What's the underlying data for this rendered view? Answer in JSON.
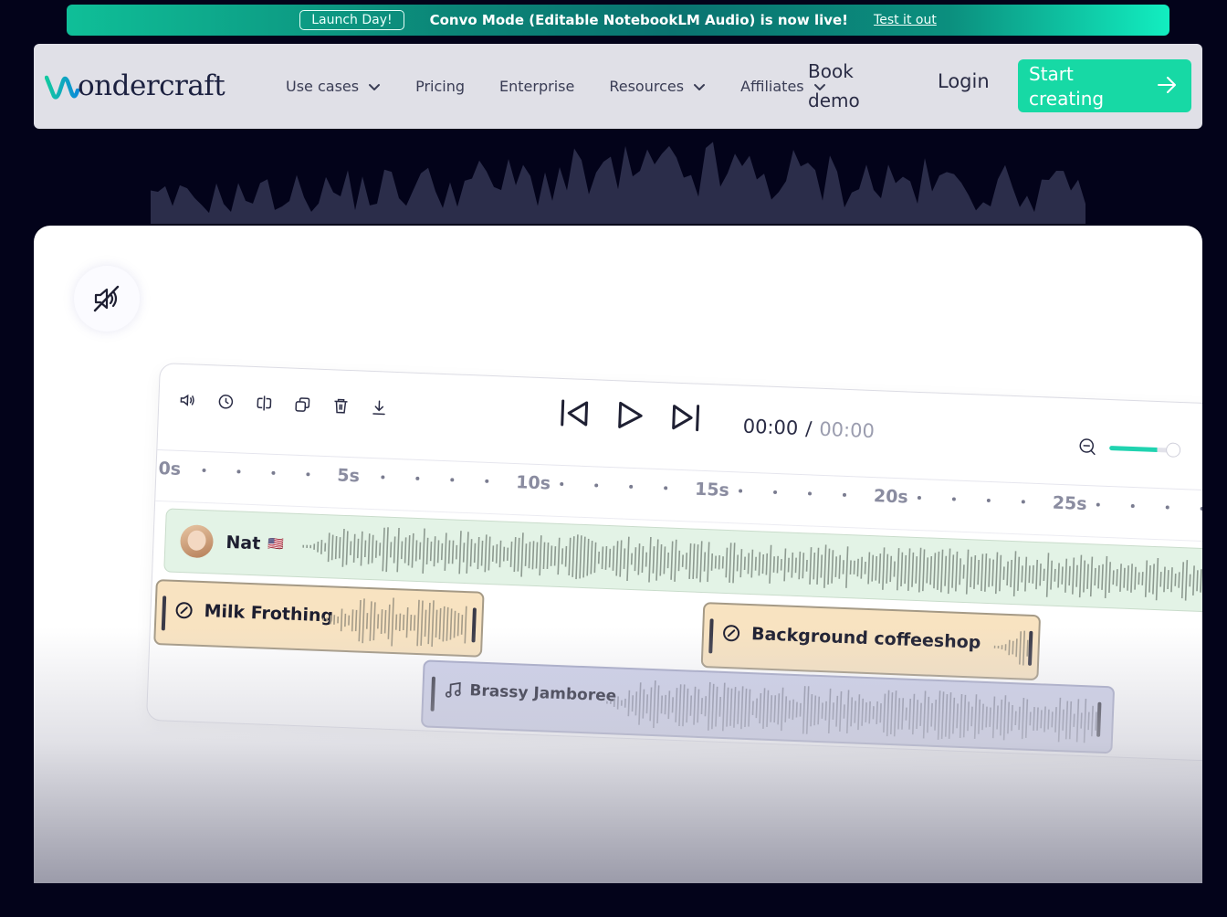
{
  "banner": {
    "tag": "Launch Day!",
    "message": "Convo Mode (Editable NotebookLM Audio) is now live!",
    "cta": "Test it out"
  },
  "nav": {
    "logo_text": "ondercraft",
    "items": [
      {
        "label": "Use cases",
        "has_dropdown": true
      },
      {
        "label": "Pricing",
        "has_dropdown": false
      },
      {
        "label": "Enterprise",
        "has_dropdown": false
      },
      {
        "label": "Resources",
        "has_dropdown": true
      },
      {
        "label": "Affiliates",
        "has_dropdown": true
      }
    ],
    "book_demo_line1": "Book",
    "book_demo_line2": "demo",
    "login": "Login",
    "start_line1": "Start",
    "start_line2": "creating"
  },
  "editor": {
    "current_time": "00:00",
    "separator": "/",
    "duration": "00:00",
    "zoom_level": 0.75,
    "ruler": [
      "0s",
      "5s",
      "10s",
      "15s",
      "20s",
      "25s"
    ],
    "tracks": {
      "voice": {
        "name": "Nat",
        "flag": "🇺🇸"
      },
      "sfx1": {
        "name": "Milk Frothing"
      },
      "sfx2": {
        "name": "Background coffeeshop"
      },
      "music": {
        "name": "Brassy Jamboree"
      }
    }
  },
  "colors": {
    "accent": "#17d9a5",
    "background": "#03031a",
    "nav_bg": "#e0e0e7"
  },
  "icons": [
    "mute-icon",
    "volume-icon",
    "clock-icon",
    "split-icon",
    "duplicate-icon",
    "trash-icon",
    "download-icon",
    "skip-back-icon",
    "play-icon",
    "skip-forward-icon",
    "zoom-out-icon",
    "arrow-right-icon",
    "chevron-down-icon",
    "sfx-icon",
    "music-icon"
  ]
}
